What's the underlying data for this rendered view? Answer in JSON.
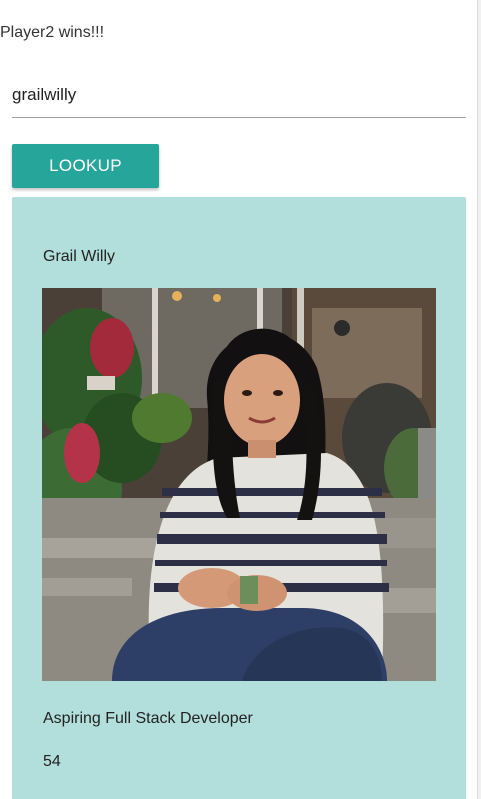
{
  "status": {
    "message": "Player2 wins!!!"
  },
  "search": {
    "value": "grailwilly"
  },
  "lookup": {
    "label": "LOOKUP"
  },
  "profile": {
    "name": "Grail Willy",
    "title": "Aspiring Full Stack Developer",
    "number": "54",
    "photo_alt": "profile-photo"
  },
  "colors": {
    "accent": "#26a69a",
    "card_background": "#b2dfdb"
  }
}
